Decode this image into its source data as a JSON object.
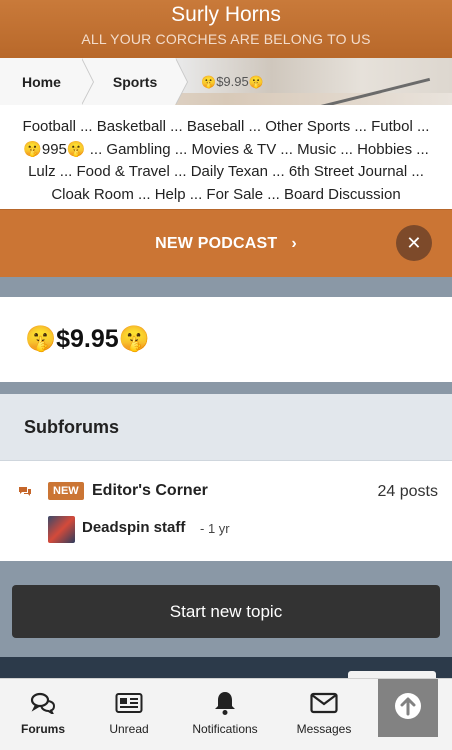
{
  "header": {
    "title": "Surly Horns",
    "tagline": "ALL YOUR CORCHES ARE BELONG TO US"
  },
  "breadcrumb": {
    "home": "Home",
    "sports": "Sports",
    "current_prefix": "🤫",
    "current": "$9.95",
    "current_suffix": "🤫"
  },
  "categories": {
    "line1": [
      "Football",
      "Basketball",
      "Baseball",
      "Other Sports",
      "Futbol ..."
    ],
    "line2": [
      "🤫995🤫",
      "Gambling",
      "Movies & TV",
      "Music",
      "Hobbies ..."
    ],
    "line3": [
      "Lulz",
      "Food & Travel",
      "Daily Texan",
      "6th Street Journal ..."
    ],
    "line4": [
      "Cloak Room",
      "Help",
      "For Sale",
      "Board Discussion"
    ],
    "separator": " ... "
  },
  "podcast": {
    "label": "NEW PODCAST",
    "chevron": "›",
    "close": "✕"
  },
  "forum": {
    "title": "🤫$9.95🤫"
  },
  "subforums": {
    "heading": "Subforums",
    "items": [
      {
        "badge": "NEW",
        "name": "Editor's Corner",
        "posts": "24 posts",
        "last_user": "Deadspin staff",
        "last_time": "1 yr",
        "time_sep": "-"
      }
    ]
  },
  "actions": {
    "start_topic": "Start new topic"
  },
  "bottom_nav": {
    "items": [
      {
        "label": "Forums",
        "icon": "forums-icon",
        "active": true
      },
      {
        "label": "Unread",
        "icon": "unread-icon",
        "active": false
      },
      {
        "label": "Notifications",
        "icon": "bell-icon",
        "active": false
      },
      {
        "label": "Messages",
        "icon": "envelope-icon",
        "active": false
      }
    ]
  },
  "colors": {
    "accent": "#cb7534",
    "header": "#c0702f",
    "dark_button": "#333333"
  }
}
